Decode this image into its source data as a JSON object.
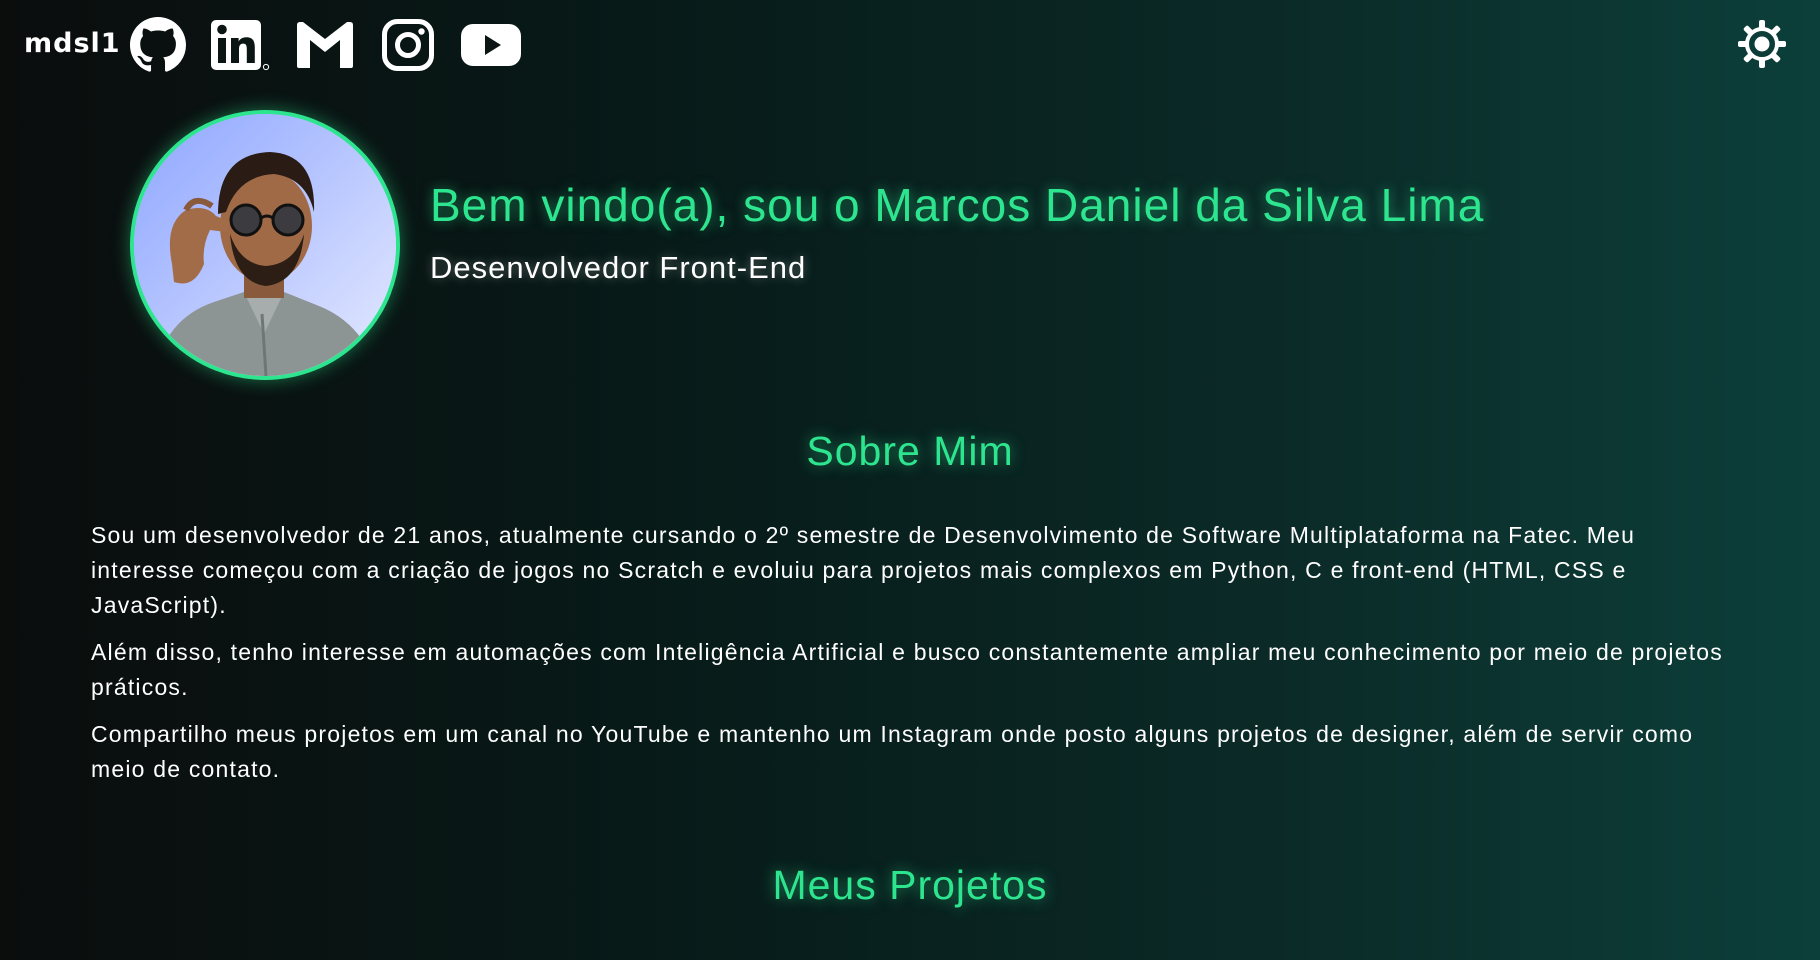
{
  "header": {
    "logo": "mdsl1",
    "social": [
      {
        "name": "github-icon"
      },
      {
        "name": "linkedin-icon"
      },
      {
        "name": "gmail-icon"
      },
      {
        "name": "instagram-icon"
      },
      {
        "name": "youtube-icon"
      }
    ],
    "theme_toggle_icon": "brightness-gear-icon"
  },
  "hero": {
    "title": "Bem vindo(a), sou o Marcos Daniel da Silva Lima",
    "subtitle": "Desenvolvedor Front-End"
  },
  "about": {
    "title": "Sobre Mim",
    "paragraphs": [
      "Sou um desenvolvedor de 21 anos, atualmente cursando o 2º semestre de Desenvolvimento de Software Multiplataforma na Fatec. Meu interesse começou com a criação de jogos no Scratch e evoluiu para projetos mais complexos em Python, C e front-end (HTML, CSS e JavaScript).",
      "Além disso, tenho interesse em automações com Inteligência Artificial e busco constantemente ampliar meu conhecimento por meio de projetos práticos.",
      "Compartilho meus projetos em um canal no YouTube e mantenho um Instagram onde posto alguns projetos de designer, além de servir como meio de contato."
    ]
  },
  "projects": {
    "title": "Meus Projetos"
  },
  "colors": {
    "accent": "#2ee58f",
    "text": "#ffffff",
    "background_start": "#0b0d0d",
    "background_end": "#0c3f3a"
  }
}
